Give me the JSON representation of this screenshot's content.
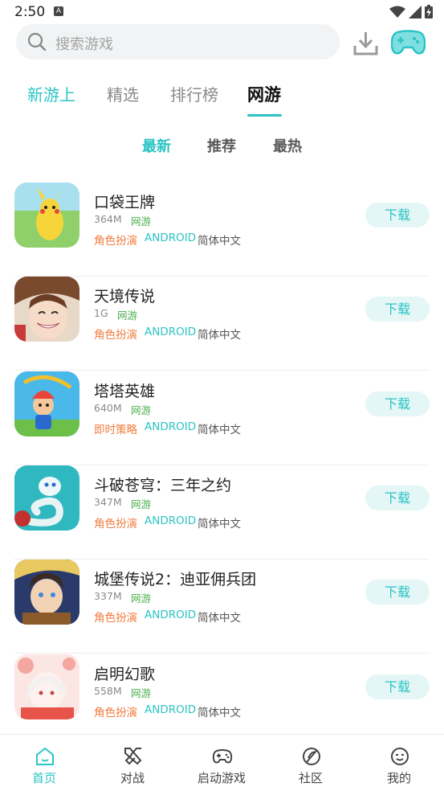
{
  "status_bar": {
    "time": "2:50",
    "notif_letter": "A"
  },
  "search": {
    "placeholder": "搜索游戏"
  },
  "main_tabs": [
    "新游上",
    "精选",
    "排行榜",
    "网游"
  ],
  "sub_tabs": [
    "最新",
    "推荐",
    "最热"
  ],
  "games": [
    {
      "name": "口袋王牌",
      "size": "364M",
      "type": "网游",
      "genre": "角色扮演",
      "platform": "ANDROID",
      "lang": "简体中文",
      "button": "下载"
    },
    {
      "name": "天境传说",
      "size": "1G",
      "type": "网游",
      "genre": "角色扮演",
      "platform": "ANDROID",
      "lang": "简体中文",
      "button": "下载"
    },
    {
      "name": "塔塔英雄",
      "size": "640M",
      "type": "网游",
      "genre": "即时策略",
      "platform": "ANDROID",
      "lang": "简体中文",
      "button": "下载"
    },
    {
      "name": "斗破苍穹：三年之约",
      "size": "347M",
      "type": "网游",
      "genre": "角色扮演",
      "platform": "ANDROID",
      "lang": "简体中文",
      "button": "下载"
    },
    {
      "name": "城堡传说2：迪亚佣兵团",
      "size": "337M",
      "type": "网游",
      "genre": "角色扮演",
      "platform": "ANDROID",
      "lang": "简体中文",
      "button": "下载"
    },
    {
      "name": "启明幻歌",
      "size": "558M",
      "type": "网游",
      "genre": "角色扮演",
      "platform": "ANDROID",
      "lang": "简体中文",
      "button": "下载"
    }
  ],
  "bottom_nav": [
    "首页",
    "对战",
    "启动游戏",
    "社区",
    "我的"
  ],
  "colors": {
    "accent": "#2cc4c4",
    "genre": "#f07a3a",
    "type": "#4cae4c"
  }
}
